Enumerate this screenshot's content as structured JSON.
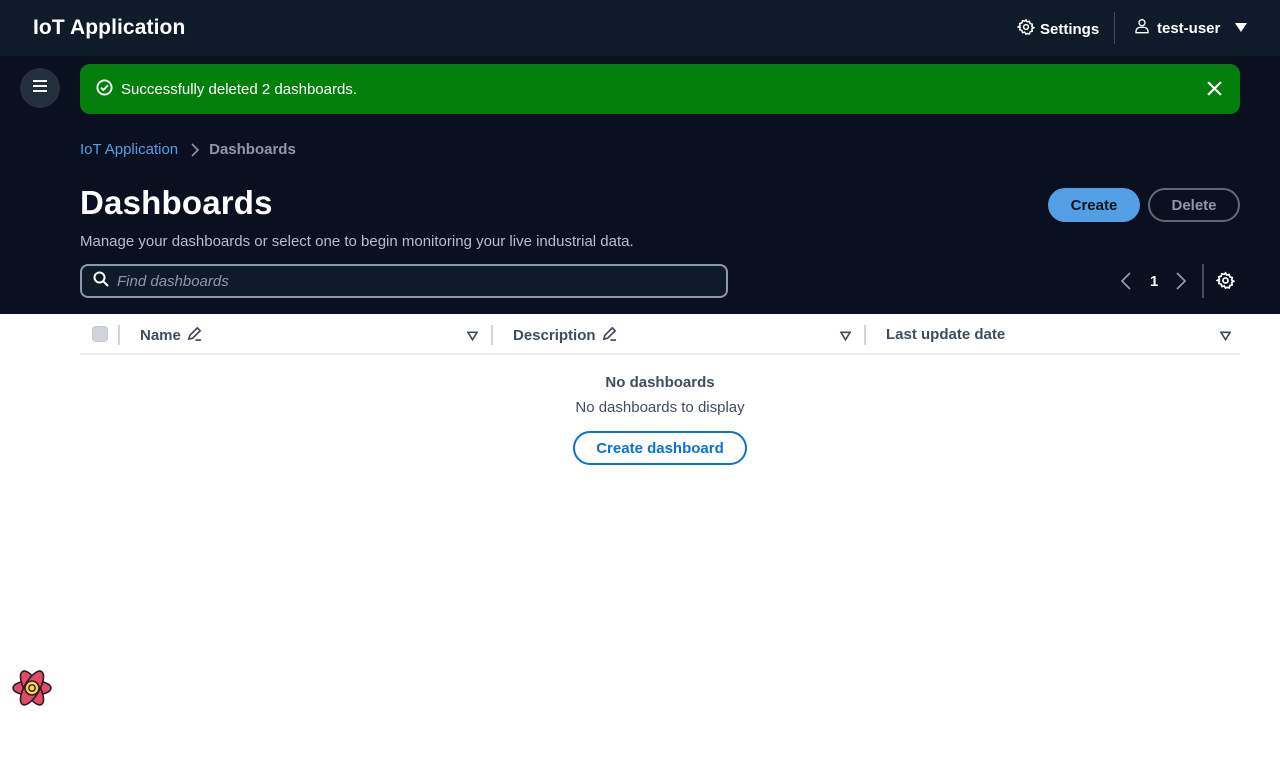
{
  "topnav": {
    "title": "IoT Application",
    "settings_label": "Settings",
    "user_label": "test-user"
  },
  "flash": {
    "message": "Successfully deleted 2 dashboards.",
    "type": "success",
    "color": "#037f0c"
  },
  "breadcrumb": {
    "items": [
      "IoT Application",
      "Dashboards"
    ]
  },
  "header": {
    "title": "Dashboards",
    "description": "Manage your dashboards or select one to begin monitoring your live industrial data.",
    "create_label": "Create",
    "delete_label": "Delete"
  },
  "search": {
    "placeholder": "Find dashboards",
    "value": ""
  },
  "pagination": {
    "current_page": "1"
  },
  "table": {
    "columns": [
      "Name",
      "Description",
      "Last update date"
    ],
    "rows": []
  },
  "empty_state": {
    "title": "No dashboards",
    "subtitle": "No dashboards to display",
    "action_label": "Create dashboard"
  },
  "colors": {
    "nav_bg": "#0f1b2a",
    "header_bg": "#0a1020",
    "primary": "#539fe5",
    "link": "#0972d3",
    "success": "#037f0c"
  },
  "icons": [
    "settings-icon",
    "user-icon",
    "caret-down-icon",
    "menu-icon",
    "check-circle-icon",
    "close-icon",
    "chevron-right-icon",
    "search-icon",
    "chevron-left-icon",
    "gear-icon",
    "edit-icon",
    "sort-icon",
    "react-devtools-icon"
  ]
}
